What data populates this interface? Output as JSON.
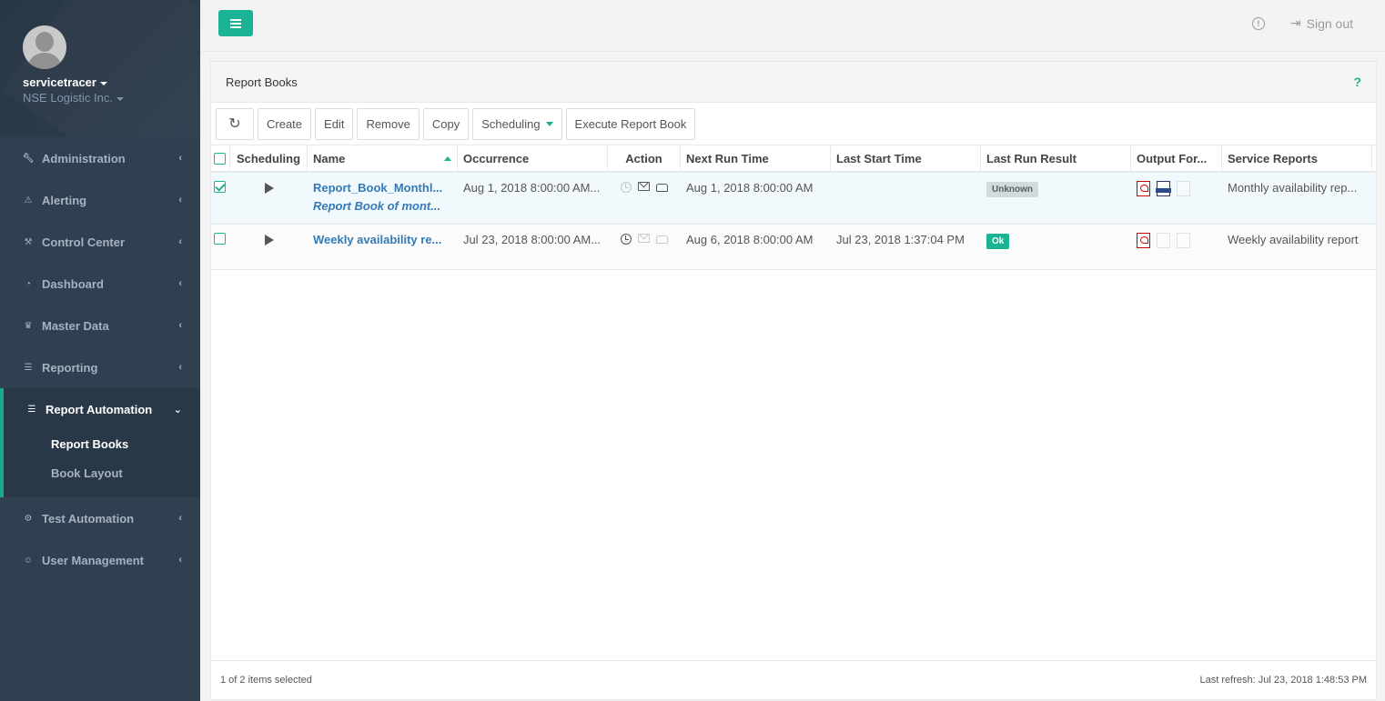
{
  "user": {
    "name": "servicetracer",
    "org": "NSE Logistic Inc."
  },
  "sidebar": {
    "items": [
      {
        "label": "Administration",
        "icon": "wrench-icon"
      },
      {
        "label": "Alerting",
        "icon": "warning-icon"
      },
      {
        "label": "Control Center",
        "icon": "tools-icon"
      },
      {
        "label": "Dashboard",
        "icon": "pie-chart-icon"
      },
      {
        "label": "Master Data",
        "icon": "crown-icon"
      },
      {
        "label": "Reporting",
        "icon": "document-icon"
      },
      {
        "label": "Report Automation",
        "icon": "report-gear-icon"
      },
      {
        "label": "Test Automation",
        "icon": "gear-icon"
      },
      {
        "label": "User Management",
        "icon": "users-icon"
      }
    ],
    "sub": [
      {
        "label": "Report Books"
      },
      {
        "label": "Book Layout"
      }
    ]
  },
  "topbar": {
    "signout": "Sign out"
  },
  "panel": {
    "title": "Report Books",
    "help": "?"
  },
  "toolbar": {
    "create": "Create",
    "edit": "Edit",
    "remove": "Remove",
    "copy": "Copy",
    "scheduling": "Scheduling",
    "execute": "Execute Report Book"
  },
  "table": {
    "headers": {
      "scheduling": "Scheduling",
      "name": "Name",
      "occurrence": "Occurrence",
      "action": "Action",
      "next_run": "Next Run Time",
      "last_start": "Last Start Time",
      "last_result": "Last Run Result",
      "output": "Output For...",
      "service": "Service Reports"
    },
    "rows": [
      {
        "name": "Report_Book_Monthl...",
        "description": "Report Book of mont...",
        "occurrence": "Aug 1, 2018 8:00:00 AM...",
        "next_run": "Aug 1, 2018 8:00:00 AM",
        "last_start": "",
        "result": "Unknown",
        "service": "Monthly availability rep..."
      },
      {
        "name": "Weekly availability re...",
        "occurrence": "Jul 23, 2018 8:00:00 AM...",
        "next_run": "Aug 6, 2018 8:00:00 AM",
        "last_start": "Jul 23, 2018 1:37:04 PM",
        "result": "Ok",
        "service": "Weekly availability report"
      }
    ]
  },
  "footer": {
    "selected": "1 of 2 items selected",
    "refresh": "Last refresh: Jul 23, 2018 1:48:53 PM"
  },
  "colors": {
    "accent": "#1ab394",
    "sidebar": "#2f4050",
    "link": "#337ab7"
  }
}
